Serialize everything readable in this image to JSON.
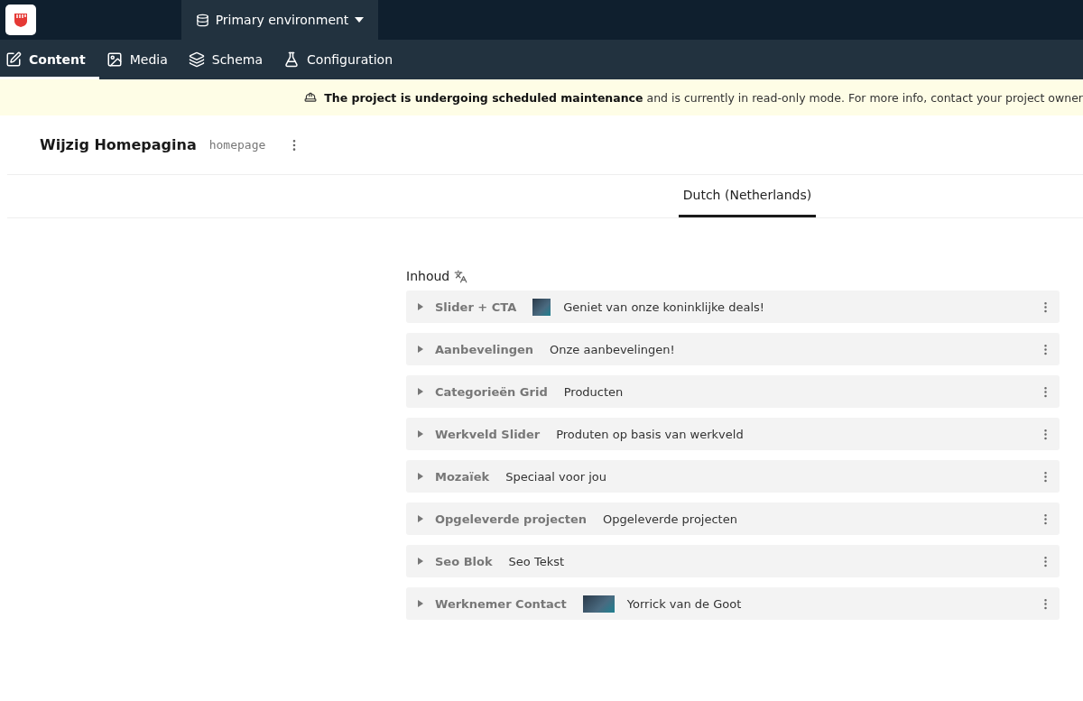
{
  "environment": {
    "label": "Primary environment"
  },
  "nav_tabs": [
    {
      "label": "Content",
      "selected": true
    },
    {
      "label": "Media",
      "selected": false
    },
    {
      "label": "Schema",
      "selected": false
    },
    {
      "label": "Configuration",
      "selected": false
    }
  ],
  "banner": {
    "text": "**The project is undergoing scheduled maintenance** and is currently in read-only mode. For more info, contact your project owner"
  },
  "header": {
    "title": "Wijzig Homepagina",
    "slug": "homepage"
  },
  "locale_tabs": [
    {
      "label": "Dutch (Netherlands)",
      "selected": true
    }
  ],
  "field": {
    "label": "Inhoud"
  },
  "blocks": [
    {
      "type": "Slider + CTA",
      "thumbnail": true,
      "summary": "Geniet van onze koninklijke deals!",
      "expanded": false
    },
    {
      "type": "Aanbevelingen",
      "thumbnail": false,
      "summary": "Onze aanbevelingen!",
      "expanded": false
    },
    {
      "type": "Categorieën Grid",
      "thumbnail": false,
      "summary": "Producten",
      "expanded": false
    },
    {
      "type": "Werkveld Slider",
      "thumbnail": false,
      "summary": "Produten op basis van werkveld",
      "expanded": false
    },
    {
      "type": "Mozaïek",
      "thumbnail": false,
      "summary": "Speciaal voor jou",
      "expanded": false
    },
    {
      "type": "Opgeleverde projecten",
      "thumbnail": false,
      "summary": "Opgeleverde projecten",
      "expanded": false
    },
    {
      "type": "Seo Blok",
      "thumbnail": false,
      "summary": "Seo Tekst",
      "expanded": false
    },
    {
      "type": "Werknemer Contact",
      "thumbnail": true,
      "summary": "Yorrick van de Goot",
      "expanded": false
    }
  ]
}
